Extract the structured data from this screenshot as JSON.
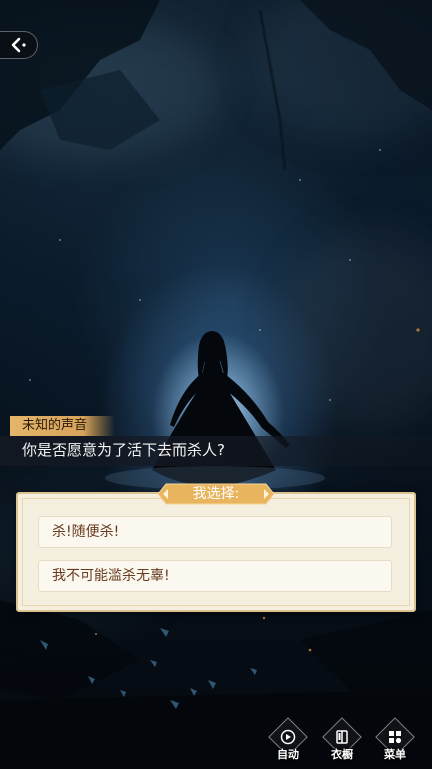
{
  "dialogue": {
    "speaker": "未知的声音",
    "text": "你是否愿意为了活下去而杀人?"
  },
  "choice": {
    "title": "我选择:",
    "options": [
      {
        "label": "杀!随便杀!"
      },
      {
        "label": "我不可能滥杀无辜!"
      }
    ]
  },
  "controls": {
    "auto": {
      "label": "自动",
      "icon": "play-icon"
    },
    "wardrobe": {
      "label": "衣橱",
      "icon": "wardrobe-icon"
    },
    "menu": {
      "label": "菜单",
      "icon": "menu-grid-icon"
    }
  },
  "colors": {
    "speaker_tag": "#e4b56a",
    "choice_title": "#e9b45e",
    "choice_text": "#6a3a1e",
    "panel_bg": "#f5efdf"
  }
}
